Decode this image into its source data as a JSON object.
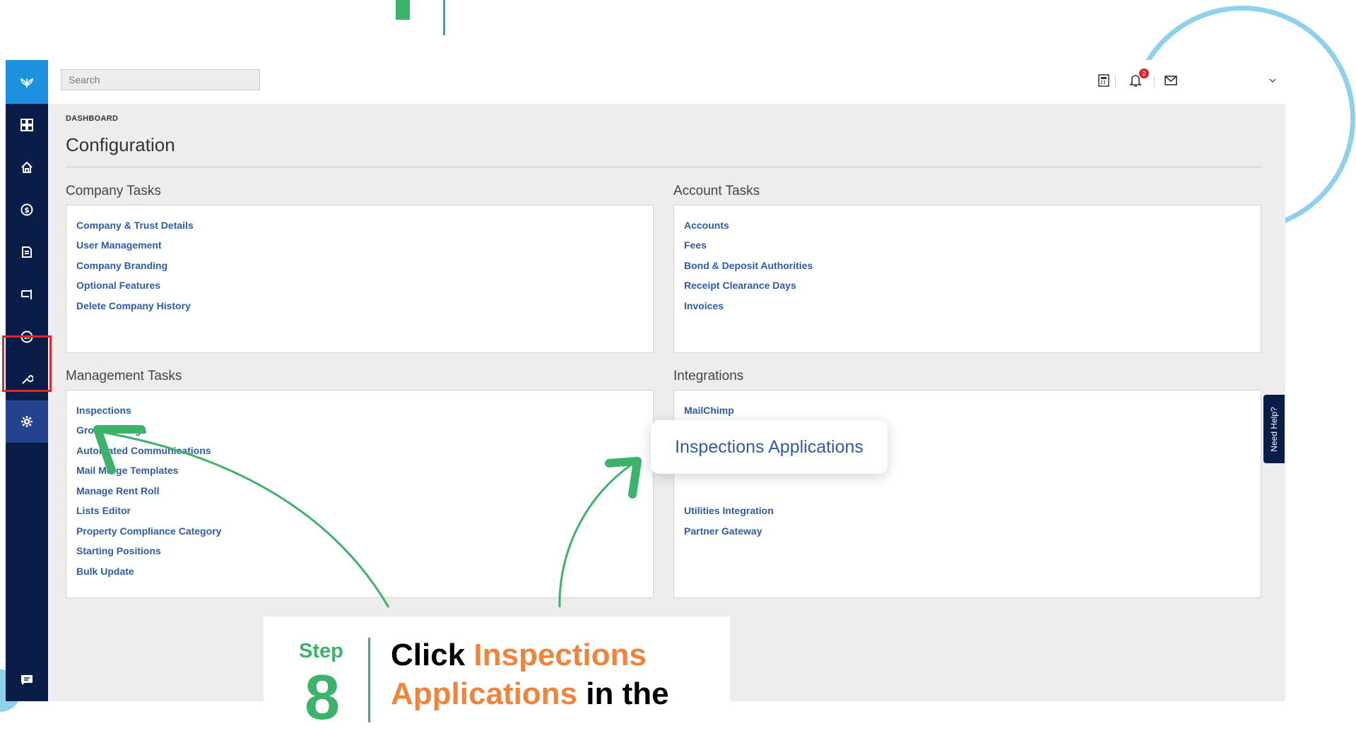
{
  "search": {
    "placeholder": "Search"
  },
  "topbar": {
    "notification_count": "2"
  },
  "sidebar": {
    "items": [
      {
        "icon": "dashboard-icon"
      },
      {
        "icon": "home-icon"
      },
      {
        "icon": "dollar-icon"
      },
      {
        "icon": "document-icon"
      },
      {
        "icon": "tray-icon"
      },
      {
        "icon": "bi-icon"
      },
      {
        "icon": "wrench-icon"
      },
      {
        "icon": "gear-icon",
        "active": true
      },
      {
        "icon": "chat-icon"
      }
    ]
  },
  "breadcrumb": "DASHBOARD",
  "page_title": "Configuration",
  "company_tasks": {
    "title": "Company Tasks",
    "links": [
      "Company & Trust Details",
      "User Management",
      "Company Branding",
      "Optional Features",
      "Delete Company History"
    ]
  },
  "account_tasks": {
    "title": "Account Tasks",
    "links": [
      "Accounts",
      "Fees",
      "Bond & Deposit Authorities",
      "Receipt Clearance Days",
      "Invoices"
    ]
  },
  "management_tasks": {
    "title": "Management Tasks",
    "links": [
      "Inspections",
      "Groups & Tags",
      "Automated Communications",
      "Mail Merge Templates",
      "Manage Rent Roll",
      "Lists Editor",
      "Property Compliance Category",
      "Starting Positions",
      "Bulk Update"
    ]
  },
  "integrations": {
    "title": "Integrations",
    "links": [
      "MailChimp",
      "",
      "",
      "",
      "Utilities Integration",
      "Partner Gateway"
    ]
  },
  "need_help": "Need Help?",
  "callout": "Inspections Applications",
  "step": {
    "label": "Step",
    "number": "8",
    "line1_prefix": "Click ",
    "line1_highlight": "Inspections",
    "line2_highlight": "Applications",
    "line2_suffix": " in the"
  },
  "colors": {
    "sidebar": "#0a1c48",
    "sidebar_logo": "#1b91e0",
    "sidebar_active": "#23438f",
    "link": "#2f5ba8",
    "accent_green": "#3cb36a",
    "accent_orange": "#f0843a",
    "highlight_box": "#e3252b"
  }
}
